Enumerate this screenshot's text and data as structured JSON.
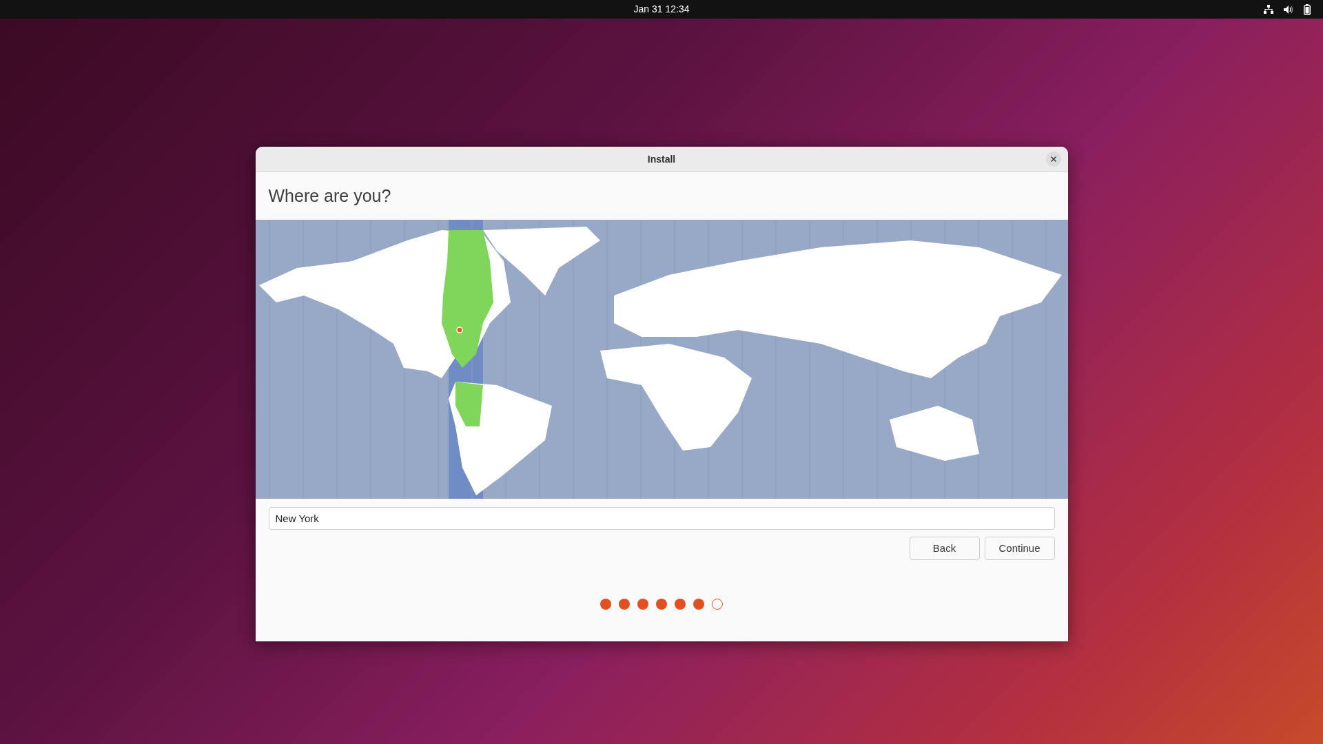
{
  "top_bar": {
    "clock": "Jan 31  12:34"
  },
  "window": {
    "title": "Install"
  },
  "heading": "Where are you?",
  "location_field": {
    "value": "New York"
  },
  "buttons": [
    {
      "label": "Back"
    },
    {
      "label": "Continue"
    }
  ],
  "progress": [
    {
      "done": true
    },
    {
      "done": true
    },
    {
      "done": true
    },
    {
      "done": true
    },
    {
      "done": true
    },
    {
      "done": true
    },
    {
      "done": false
    }
  ]
}
